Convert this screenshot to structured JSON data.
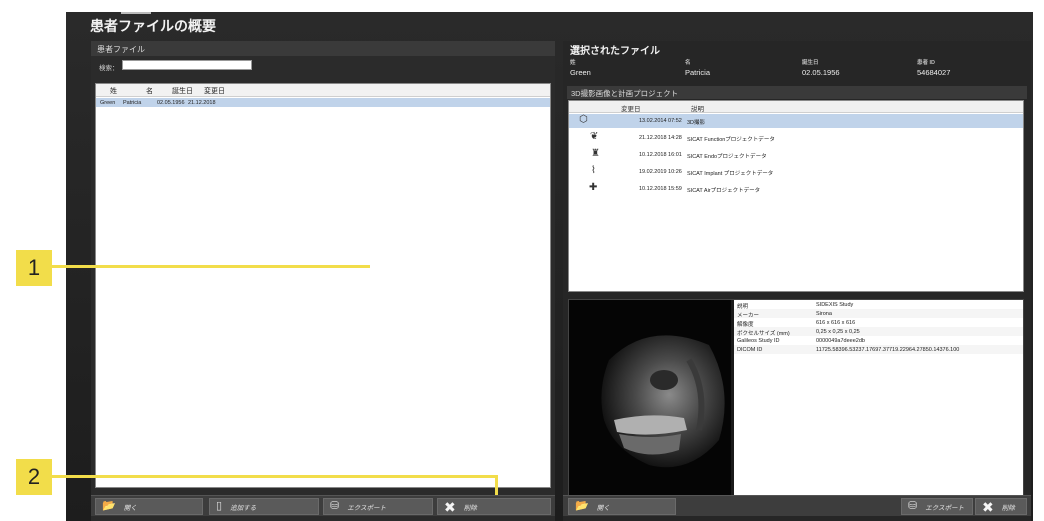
{
  "window": {
    "title": "患者ファイルの概要"
  },
  "patient_panel": {
    "title": "患者ファイル",
    "search_label": "検索：",
    "search_value": "",
    "columns": [
      "姓",
      "名",
      "誕生日",
      "変更日"
    ],
    "rows": [
      {
        "last": "Green",
        "first": "Patricia",
        "birth": "02.05.1956",
        "modified": "21.12.2018"
      }
    ]
  },
  "left_buttons": {
    "open": "開く",
    "add": "追加する",
    "export": "エクスポート",
    "delete": "削除"
  },
  "selected_file": {
    "title": "選択されたファイル",
    "labels": {
      "last": "姓",
      "first": "名",
      "birth": "誕生日",
      "patient_id": "患者 ID"
    },
    "values": {
      "last": "Green",
      "first": "Patricia",
      "birth": "02.05.1956",
      "patient_id": "54684027"
    }
  },
  "studies": {
    "title": "3D撮影画像と計画プロジェクト",
    "columns": [
      "変更日",
      "説明"
    ],
    "rows": [
      {
        "icon": "cube-icon",
        "date": "13.02.2014 07:52",
        "desc": "3D撮影"
      },
      {
        "icon": "jaw-icon",
        "date": "21.12.2018 14:28",
        "desc": "SICAT Functionプロジェクトデータ"
      },
      {
        "icon": "tooth-icon",
        "date": "10.12.2018 16:01",
        "desc": "SICAT Endoプロジェクトデータ"
      },
      {
        "icon": "implant-icon",
        "date": "19.02.2019 10:26",
        "desc": "SICAT Implant プロジェクトデータ"
      },
      {
        "icon": "airway-icon",
        "date": "10.12.2018 15:59",
        "desc": "SICAT Airプロジェクトデータ"
      }
    ]
  },
  "metadata": [
    {
      "k": "説明",
      "v": "SIDEXIS Study"
    },
    {
      "k": "メーカー",
      "v": "Sirona"
    },
    {
      "k": "解像度",
      "v": "616 x 616 x 616"
    },
    {
      "k": "ボクセルサイズ (mm)",
      "v": "0,25 x 0,25 x 0,25"
    },
    {
      "k": "Galileos Study ID",
      "v": "0000049a7deee2db"
    },
    {
      "k": "DICOM ID",
      "v": "11725.58396.53237.17697.37719.22964.27850.14376.100"
    }
  ],
  "right_buttons": {
    "open": "開く",
    "export": "エクスポート",
    "delete": "削除"
  },
  "callouts": [
    "1",
    "2"
  ],
  "colors": {
    "accent_yellow": "#f2dd4a",
    "selection": "#c0d3ea",
    "panel_bg": "#2b2b2b"
  }
}
